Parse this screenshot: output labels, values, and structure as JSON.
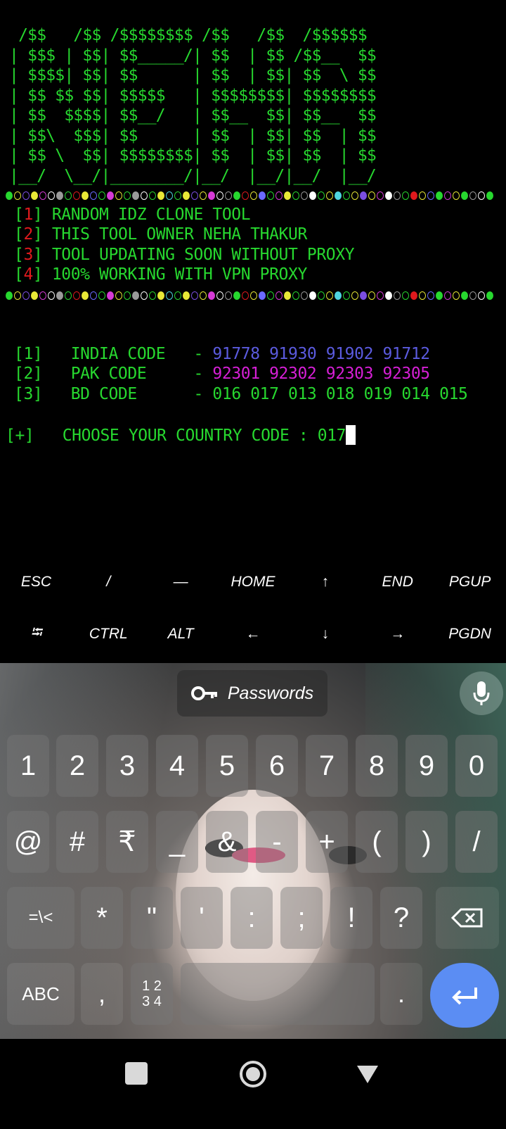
{
  "logo_ascii": "  /$$   /$$ /$$$$$$$$ /$$   /$$  /$$$$$$\n | $$$ | $$| $$_____/| $$  | $$ /$$__  $$\n | $$$$| $$| $$      | $$  | $$| $$  \\ $$\n | $$ $$ $$| $$$$$   | $$$$$$$$| $$$$$$$$\n | $$  $$$$| $$__/   | $$__  $$| $$__  $$\n | $$\\  $$$| $$      | $$  | $$| $$  | $$\n | $$ \\  $$| $$$$$$$$| $$  | $$| $$  | $$\n |__/  \\__/|________/|__/  |__/|__/  |__/",
  "dot_colors": [
    "#27d82f",
    "#e8e837",
    "#7b4ee0",
    "#e8e837",
    "#d63ad6",
    "#ffffff",
    "#9a9a9a",
    "#27d82f",
    "#e0191d",
    "#e8e837",
    "#6a6aff",
    "#27d82f",
    "#d63ad6",
    "#e8e837",
    "#27d82f",
    "#9a9a9a",
    "#ffffff",
    "#27d82f",
    "#e8e837",
    "#4fd5e0"
  ],
  "menu": [
    {
      "num": "1",
      "text": "RANDOM IDZ CLONE TOOL"
    },
    {
      "num": "2",
      "text": "THIS TOOL OWNER NEHA THAKUR"
    },
    {
      "num": "3",
      "text": "TOOL UPDATING SOON WITHOUT PROXY"
    },
    {
      "num": "4",
      "text": "100% WORKING WITH VPN PROXY"
    }
  ],
  "codes": [
    {
      "num": "[1]",
      "label": "INDIA CODE",
      "sep": "-",
      "values": "91778 91930 91902 91712",
      "color": "#5b5bdf"
    },
    {
      "num": "[2]",
      "label": "PAK CODE  ",
      "sep": "-",
      "values": "92301 92302 92303 92305",
      "color": "#d61fd6"
    },
    {
      "num": "[3]",
      "label": "BD CODE   ",
      "sep": "-",
      "values": "016 017 013 018 019 014 015",
      "color": "#27d82f"
    }
  ],
  "prompt": {
    "prefix": "[+]",
    "text": "CHOOSE YOUR COUNTRY CODE : ",
    "input": "017"
  },
  "extra_keys": {
    "row1": [
      "ESC",
      "/",
      "—",
      "HOME",
      "↑",
      "END",
      "PGUP"
    ],
    "row2": [
      "⭾",
      "CTRL",
      "ALT",
      "←",
      "↓",
      "→",
      "PGDN"
    ]
  },
  "keyboard": {
    "suggestion": "Passwords",
    "row1": [
      "1",
      "2",
      "3",
      "4",
      "5",
      "6",
      "7",
      "8",
      "9",
      "0"
    ],
    "row2": [
      "@",
      "#",
      "₹",
      "_",
      "&",
      "-",
      "+",
      "(",
      ")",
      "/"
    ],
    "row3": [
      "=\\<",
      "*",
      "\"",
      "'",
      ":",
      ";",
      "!",
      "?"
    ],
    "row4_abc": "ABC",
    "row4_comma": ",",
    "row4_numpad": "1 2\n3 4",
    "row4_period": "."
  }
}
